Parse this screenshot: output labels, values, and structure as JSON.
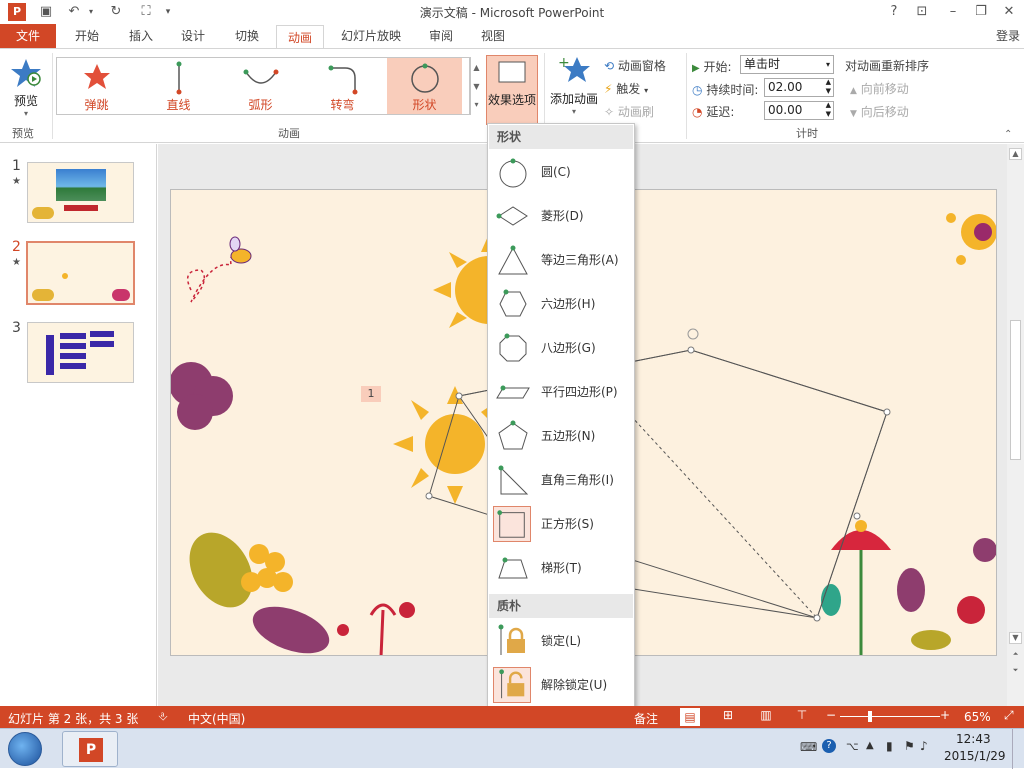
{
  "window": {
    "title": "演示文稿 - Microsoft PowerPoint",
    "help": "?",
    "signin": "登录"
  },
  "tabs": [
    {
      "label": "文件"
    },
    {
      "label": "开始"
    },
    {
      "label": "插入"
    },
    {
      "label": "设计"
    },
    {
      "label": "切换"
    },
    {
      "label": "动画"
    },
    {
      "label": "幻灯片放映"
    },
    {
      "label": "审阅"
    },
    {
      "label": "视图"
    }
  ],
  "ribbon": {
    "preview_label": "预览",
    "preview_group": "预览",
    "animation_group": "动画",
    "gallery": [
      {
        "label": "弹跳"
      },
      {
        "label": "直线"
      },
      {
        "label": "弧形"
      },
      {
        "label": "转弯"
      },
      {
        "label": "形状"
      }
    ],
    "effect_options": "效果选项",
    "add_animation": "添加动画",
    "animation_pane": "动画窗格",
    "trigger": "触发",
    "animation_painter": "动画刷",
    "start_label": "开始:",
    "start_value": "单击时",
    "duration_label": "持续时间:",
    "duration_value": "02.00",
    "delay_label": "延迟:",
    "delay_value": "00.00",
    "reorder_title": "对动画重新排序",
    "move_earlier": "向前移动",
    "move_later": "向后移动",
    "timing_group": "计时"
  },
  "slides": [
    {
      "num": "1",
      "star": "★"
    },
    {
      "num": "2",
      "star": "★"
    },
    {
      "num": "3",
      "star": ""
    }
  ],
  "slide": {
    "anim_tag": "1"
  },
  "dropdown": {
    "section_shapes": "形状",
    "shapes": [
      {
        "label": "圆(C)",
        "icon": "circle"
      },
      {
        "label": "菱形(D)",
        "icon": "diamond"
      },
      {
        "label": "等边三角形(A)",
        "icon": "triangle"
      },
      {
        "label": "六边形(H)",
        "icon": "hexagon"
      },
      {
        "label": "八边形(G)",
        "icon": "octagon"
      },
      {
        "label": "平行四边形(P)",
        "icon": "parallelogram"
      },
      {
        "label": "五边形(N)",
        "icon": "pentagon"
      },
      {
        "label": "直角三角形(I)",
        "icon": "right-triangle"
      },
      {
        "label": "正方形(S)",
        "icon": "square"
      },
      {
        "label": "梯形(T)",
        "icon": "trapezoid"
      }
    ],
    "section_path": "质朴",
    "path": [
      {
        "label": "锁定(L)",
        "icon": "lock"
      },
      {
        "label": "解除锁定(U)",
        "icon": "unlock"
      }
    ]
  },
  "status": {
    "slide_info": "幻灯片 第 2 张，共 3 张",
    "language": "中文(中国)",
    "notes": "备注",
    "zoom": "65%"
  },
  "taskbar": {
    "time": "12:43",
    "date": "2015/1/29"
  },
  "colors": {
    "accent": "#d24726",
    "selection": "#f9cdbb",
    "sun": "#f4b42a"
  }
}
